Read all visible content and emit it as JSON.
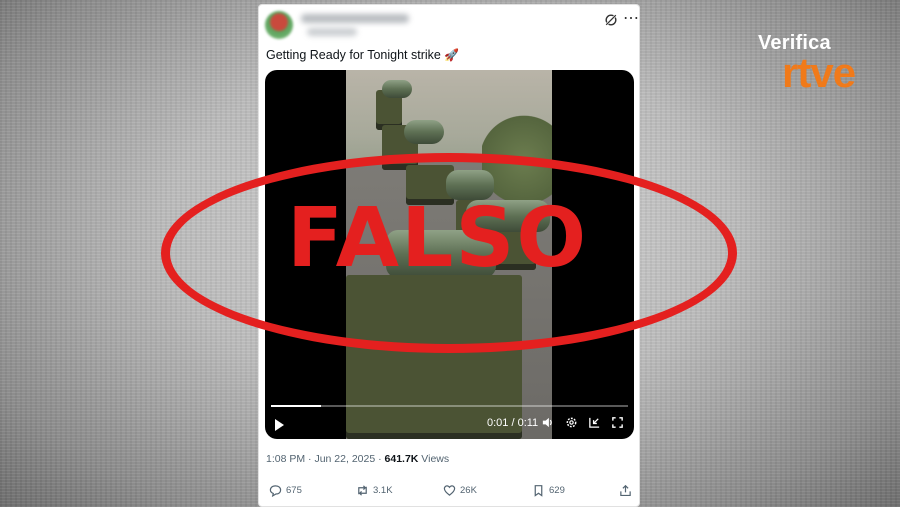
{
  "brand": {
    "line1": "Verifica",
    "line2": "rtve"
  },
  "tweet": {
    "text": "Getting Ready for Tonight strike",
    "emoji": "🚀",
    "time": "1:08 PM",
    "separator": "·",
    "date": "Jun 22, 2025",
    "views_count": "641.7K",
    "views_label": "Views"
  },
  "video": {
    "time_display": "0:01 / 0:11",
    "progress": 0.14
  },
  "actions": {
    "replies": "675",
    "reposts": "3.1K",
    "likes": "26K",
    "bookmarks": "629"
  },
  "overlay": {
    "verdict": "FALSO",
    "color": "#e4201f"
  },
  "colors": {
    "brand_orange": "#f07a1a"
  },
  "icons": [
    "grok-icon",
    "more-icon",
    "rocket-icon",
    "play-icon",
    "volume-icon",
    "settings-icon",
    "pip-icon",
    "fullscreen-icon",
    "reply-icon",
    "repost-icon",
    "like-icon",
    "bookmark-icon",
    "share-icon"
  ]
}
